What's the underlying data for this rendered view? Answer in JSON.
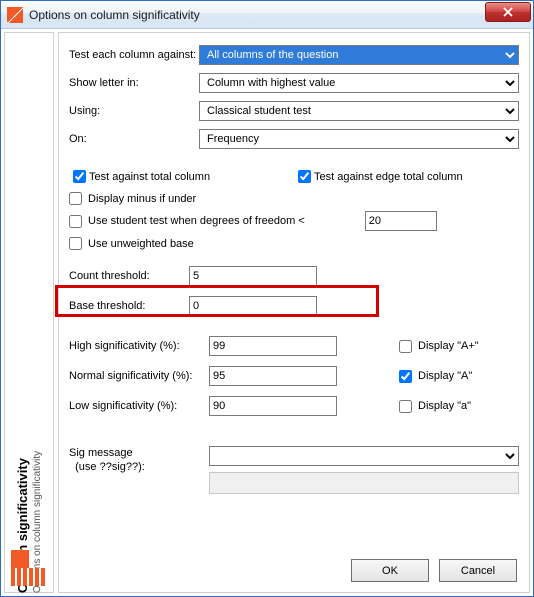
{
  "window": {
    "title": "Options on column significativity"
  },
  "sidebar": {
    "title": "Column significativity",
    "subtitle": "Options on column significativity"
  },
  "fields": {
    "test_against_label": "Test each column against:",
    "test_against_value": "All columns of the question",
    "show_letter_label": "Show letter in:",
    "show_letter_value": "Column with highest value",
    "using_label": "Using:",
    "using_value": "Classical student test",
    "on_label": "On:",
    "on_value": "Frequency"
  },
  "checks": {
    "test_total": "Test against total column",
    "test_edge_total": "Test against edge total column",
    "display_minus": "Display minus if under",
    "student_df": "Use student test when degrees of freedom <",
    "student_df_value": "20",
    "unweighted": "Use unweighted base"
  },
  "thresholds": {
    "count_label": "Count threshold:",
    "count_value": "5",
    "base_label": "Base threshold:",
    "base_value": "0"
  },
  "sig": {
    "high_label": "High significativity (%):",
    "high_value": "99",
    "high_display": "Display \"A+\"",
    "normal_label": "Normal significativity (%):",
    "normal_value": "95",
    "normal_display": "Display \"A\"",
    "low_label": "Low significativity (%):",
    "low_value": "90",
    "low_display": "Display \"a\""
  },
  "msg": {
    "label_line1": "Sig message",
    "label_line2": "(use ??sig??):",
    "value": ""
  },
  "buttons": {
    "ok": "OK",
    "cancel": "Cancel"
  }
}
